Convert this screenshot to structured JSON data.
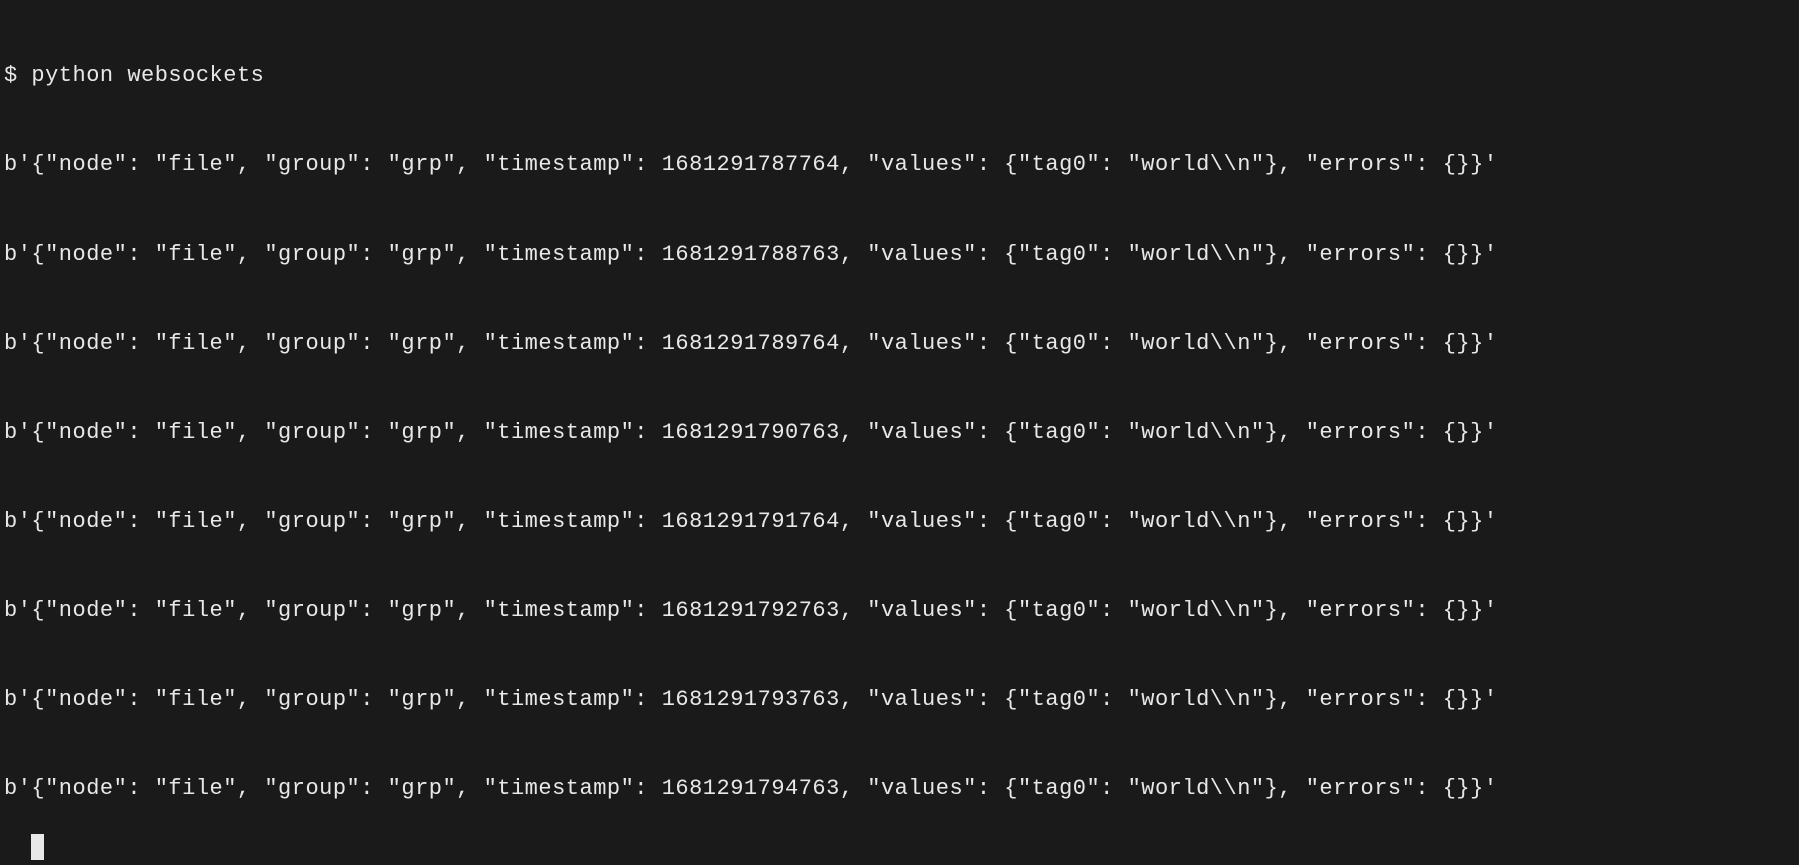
{
  "terminal": {
    "prompt_symbol": "$ ",
    "command": "python websockets",
    "output_lines": [
      "b'{\"node\": \"file\", \"group\": \"grp\", \"timestamp\": 1681291787764, \"values\": {\"tag0\": \"world\\\\n\"}, \"errors\": {}}'",
      "b'{\"node\": \"file\", \"group\": \"grp\", \"timestamp\": 1681291788763, \"values\": {\"tag0\": \"world\\\\n\"}, \"errors\": {}}'",
      "b'{\"node\": \"file\", \"group\": \"grp\", \"timestamp\": 1681291789764, \"values\": {\"tag0\": \"world\\\\n\"}, \"errors\": {}}'",
      "b'{\"node\": \"file\", \"group\": \"grp\", \"timestamp\": 1681291790763, \"values\": {\"tag0\": \"world\\\\n\"}, \"errors\": {}}'",
      "b'{\"node\": \"file\", \"group\": \"grp\", \"timestamp\": 1681291791764, \"values\": {\"tag0\": \"world\\\\n\"}, \"errors\": {}}'",
      "b'{\"node\": \"file\", \"group\": \"grp\", \"timestamp\": 1681291792763, \"values\": {\"tag0\": \"world\\\\n\"}, \"errors\": {}}'",
      "b'{\"node\": \"file\", \"group\": \"grp\", \"timestamp\": 1681291793763, \"values\": {\"tag0\": \"world\\\\n\"}, \"errors\": {}}'",
      "b'{\"node\": \"file\", \"group\": \"grp\", \"timestamp\": 1681291794763, \"values\": {\"tag0\": \"world\\\\n\"}, \"errors\": {}}'"
    ]
  }
}
